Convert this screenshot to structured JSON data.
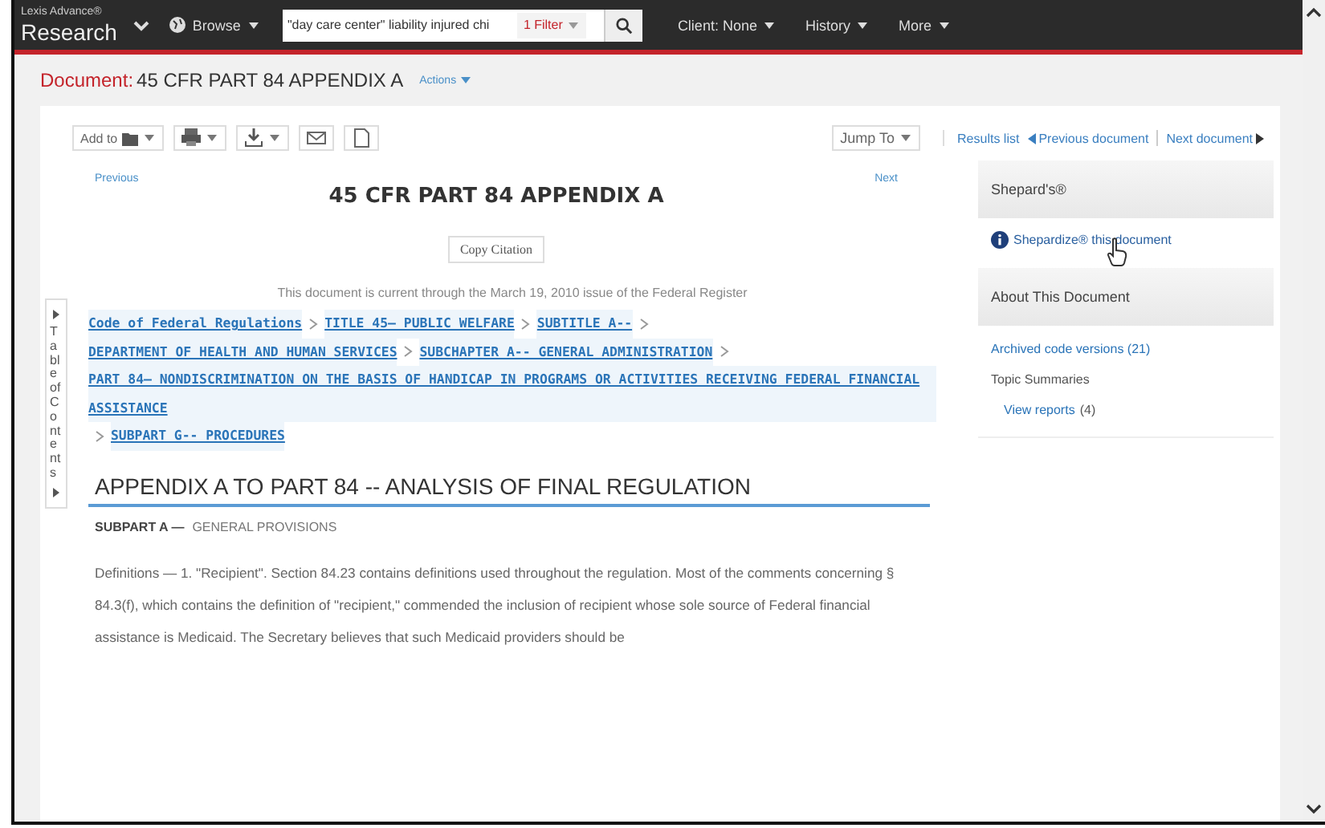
{
  "topbar": {
    "brand_small": "Lexis Advance®",
    "brand": "Research",
    "browse": "Browse",
    "search": {
      "value": "\"day care center\" liability injured chi"
    },
    "filter": "1 Filter",
    "menus": [
      "Client: None",
      "History",
      "More"
    ]
  },
  "document_header": {
    "label": "Document:",
    "title": "45 CFR PART 84 APPENDIX A",
    "actions": "Actions"
  },
  "toolbar": {
    "add_to": "Add to",
    "jump_to": "Jump To",
    "results_list": "Results list",
    "previous_document": "Previous document",
    "next_document": "Next document"
  },
  "document": {
    "previous": "Previous",
    "next": "Next",
    "title": "45 CFR PART 84 APPENDIX A",
    "copy_citation": "Copy Citation",
    "currency_note": "This document is current through the March 19, 2010 issue of the Federal Register",
    "breadcrumbs": [
      "Code of Federal Regulations",
      "TITLE 45— PUBLIC WELFARE",
      "SUBTITLE A--",
      "DEPARTMENT OF HEALTH AND HUMAN SERVICES",
      "SUBCHAPTER A-- GENERAL ADMINISTRATION",
      "PART 84— NONDISCRIMINATION ON THE BASIS OF HANDICAP IN PROGRAMS OR ACTIVITIES RECEIVING FEDERAL FINANCIAL ASSISTANCE",
      "SUBPART G-- PROCEDURES"
    ],
    "heading": "APPENDIX A TO PART 84 -- ANALYSIS OF FINAL REGULATION",
    "subpart_label": "SUBPART A —",
    "subpart_title": "GENERAL PROVISIONS",
    "paragraph": "Definitions — 1. \"Recipient\". Section 84.23 contains definitions used throughout the regulation. Most of the comments concerning § 84.3(f), which contains the definition of \"recipient,\" commended the inclusion of recipient whose sole source of Federal financial assistance is Medicaid. The Secretary believes that such Medicaid providers should be"
  },
  "toc_tab": "Table of Contents",
  "sidebar": {
    "shepards_title": "Shepard's®",
    "shepardize": "Shepardize® this document",
    "about_title": "About This Document",
    "archived": "Archived code versions (21)",
    "topic_summaries": "Topic Summaries",
    "view_reports": "View reports",
    "view_reports_count": "(4)"
  }
}
